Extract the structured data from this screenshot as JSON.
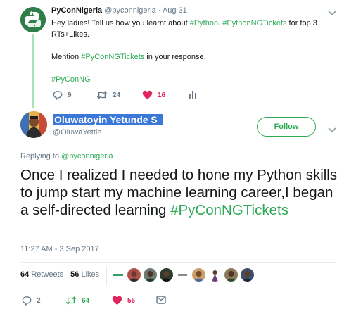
{
  "parent_tweet": {
    "author_name": "PyConNigeria",
    "author_handle": "@pyconnigeria",
    "separator": "·",
    "date": "Aug 31",
    "line1_a": "Hey ladies! Tell us how you learnt about ",
    "line1_tag1": "#Python",
    "line1_b": ". ",
    "line1_tag2": "#PythonNGTickets",
    "line1_c": " for top 3 RTs+Likes.",
    "line2_a": "Mention ",
    "line2_tag": "#PyConNGTickets",
    "line2_b": " in your response.",
    "line3_tag": "#PyConNG",
    "replies": "9",
    "retweets": "24",
    "likes": "16"
  },
  "main_tweet": {
    "author_name": "Oluwatoyin Yetunde S",
    "author_handle": "@OluwaYettie",
    "follow_label": "Follow",
    "replying_prefix": "Replying to ",
    "replying_handle": "@pyconnigeria",
    "body": "Once I realized I needed to hone my Python skills to jump start my machine learning career,I began a self-directed learning ",
    "body_hashtag": "#PyConNGTickets",
    "timestamp": "11:27 AM - 3 Sep 2017",
    "retweet_count": "64",
    "retweet_label": "Retweets",
    "like_count": "56",
    "like_label": "Likes",
    "replies": "2",
    "retweets": "64",
    "likes": "56"
  },
  "icons": [
    "python-logo-icon",
    "chevron-down-icon",
    "reply-icon",
    "retweet-icon",
    "heart-icon",
    "analytics-icon",
    "dm-envelope-icon"
  ],
  "colors": {
    "accent_green": "#2eaa56",
    "heart_red": "#e0245e",
    "text_grey": "#657786",
    "selection_blue": "#3c78d8",
    "thread_line": "#a7e3b6"
  }
}
